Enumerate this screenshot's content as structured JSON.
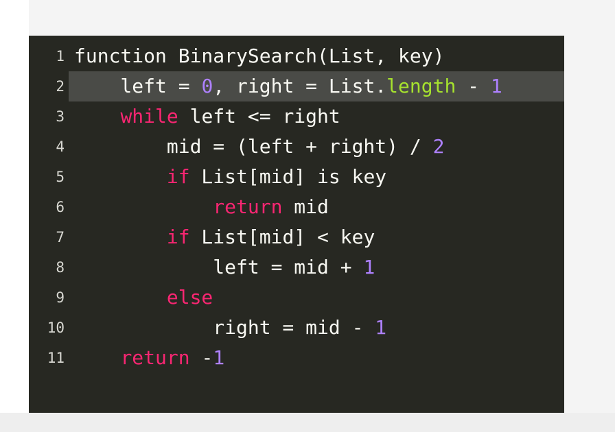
{
  "editor": {
    "language": "pseudocode",
    "highlighted_line": 2,
    "colors": {
      "background": "#272822",
      "text": "#f8f8f2",
      "keyword": "#f92672",
      "number": "#ae81ff",
      "property": "#a6e22e",
      "line_highlight": "#4a4b47"
    },
    "lines": [
      {
        "number": "1",
        "tokens": [
          {
            "t": "function BinarySearch(List, key)",
            "c": "plain"
          }
        ]
      },
      {
        "number": "2",
        "tokens": [
          {
            "t": "    left = ",
            "c": "plain"
          },
          {
            "t": "0",
            "c": "num"
          },
          {
            "t": ", right = List.",
            "c": "plain"
          },
          {
            "t": "length",
            "c": "prop"
          },
          {
            "t": " - ",
            "c": "plain"
          },
          {
            "t": "1",
            "c": "num"
          }
        ]
      },
      {
        "number": "3",
        "tokens": [
          {
            "t": "    ",
            "c": "plain"
          },
          {
            "t": "while",
            "c": "kw"
          },
          {
            "t": " left <= right",
            "c": "plain"
          }
        ]
      },
      {
        "number": "4",
        "tokens": [
          {
            "t": "        mid = (left + right) / ",
            "c": "plain"
          },
          {
            "t": "2",
            "c": "num"
          }
        ]
      },
      {
        "number": "5",
        "tokens": [
          {
            "t": "        ",
            "c": "plain"
          },
          {
            "t": "if",
            "c": "kw"
          },
          {
            "t": " List[mid] is key",
            "c": "plain"
          }
        ]
      },
      {
        "number": "6",
        "tokens": [
          {
            "t": "            ",
            "c": "plain"
          },
          {
            "t": "return",
            "c": "kw"
          },
          {
            "t": " mid",
            "c": "plain"
          }
        ]
      },
      {
        "number": "7",
        "tokens": [
          {
            "t": "        ",
            "c": "plain"
          },
          {
            "t": "if",
            "c": "kw"
          },
          {
            "t": " List[mid] < key",
            "c": "plain"
          }
        ]
      },
      {
        "number": "8",
        "tokens": [
          {
            "t": "            left = mid + ",
            "c": "plain"
          },
          {
            "t": "1",
            "c": "num"
          }
        ]
      },
      {
        "number": "9",
        "tokens": [
          {
            "t": "        ",
            "c": "plain"
          },
          {
            "t": "else",
            "c": "kw"
          }
        ]
      },
      {
        "number": "10",
        "tokens": [
          {
            "t": "            right = mid - ",
            "c": "plain"
          },
          {
            "t": "1",
            "c": "num"
          }
        ]
      },
      {
        "number": "11",
        "tokens": [
          {
            "t": "    ",
            "c": "plain"
          },
          {
            "t": "return",
            "c": "kw"
          },
          {
            "t": " -",
            "c": "plain"
          },
          {
            "t": "1",
            "c": "num"
          }
        ]
      }
    ]
  }
}
